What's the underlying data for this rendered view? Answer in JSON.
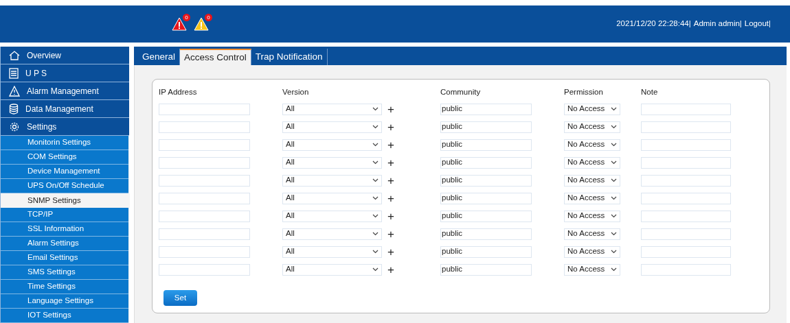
{
  "header": {
    "alarms": [
      {
        "kind": "critical",
        "count": "0"
      },
      {
        "kind": "warning",
        "count": "0"
      }
    ],
    "status": [
      "2021/12/20 22:28:44|",
      "Admin admin|",
      "Logout|"
    ]
  },
  "sidebar": {
    "items": [
      {
        "label": "Overview",
        "kind": "main",
        "selected": false
      },
      {
        "label": "U P S",
        "kind": "main",
        "selected": false
      },
      {
        "label": "Alarm Management",
        "kind": "main",
        "selected": false
      },
      {
        "label": "Data Management",
        "kind": "main",
        "selected": false
      },
      {
        "label": "Settings",
        "kind": "main",
        "selected": false
      },
      {
        "label": "Monitorin Settings",
        "kind": "sub",
        "selected": false
      },
      {
        "label": "COM Settings",
        "kind": "sub",
        "selected": false
      },
      {
        "label": "Device Management",
        "kind": "sub",
        "selected": false
      },
      {
        "label": "UPS On/Off Schedule",
        "kind": "sub",
        "selected": false
      },
      {
        "label": "SNMP Settings",
        "kind": "sub",
        "selected": true
      },
      {
        "label": "TCP/IP",
        "kind": "sub",
        "selected": false
      },
      {
        "label": "SSL Information",
        "kind": "sub",
        "selected": false
      },
      {
        "label": "Alarm Settings",
        "kind": "sub",
        "selected": false
      },
      {
        "label": "Email Settings",
        "kind": "sub",
        "selected": false
      },
      {
        "label": "SMS Settings",
        "kind": "sub",
        "selected": false
      },
      {
        "label": "Time Settings",
        "kind": "sub",
        "selected": false
      },
      {
        "label": "Language Settings",
        "kind": "sub",
        "selected": false
      },
      {
        "label": "IOT Settings",
        "kind": "sub",
        "selected": false
      }
    ]
  },
  "tabs": [
    {
      "label": "General",
      "selected": false
    },
    {
      "label": "Access Control",
      "selected": true
    },
    {
      "label": "Trap Notification",
      "selected": false
    }
  ],
  "table": {
    "columns": [
      "IP Address",
      "Version",
      "Community",
      "Permission",
      "Note"
    ],
    "rows": [
      {
        "version": "All",
        "community": "public",
        "permission": "No Access"
      },
      {
        "version": "All",
        "community": "public",
        "permission": "No Access"
      },
      {
        "version": "All",
        "community": "public",
        "permission": "No Access"
      },
      {
        "version": "All",
        "community": "public",
        "permission": "No Access"
      },
      {
        "version": "All",
        "community": "public",
        "permission": "No Access"
      },
      {
        "version": "All",
        "community": "public",
        "permission": "No Access"
      },
      {
        "version": "All",
        "community": "public",
        "permission": "No Access"
      },
      {
        "version": "All",
        "community": "public",
        "permission": "No Access"
      },
      {
        "version": "All",
        "community": "public",
        "permission": "No Access"
      },
      {
        "version": "All",
        "community": "public",
        "permission": "No Access"
      }
    ],
    "add_label": "+"
  },
  "button": "Set"
}
